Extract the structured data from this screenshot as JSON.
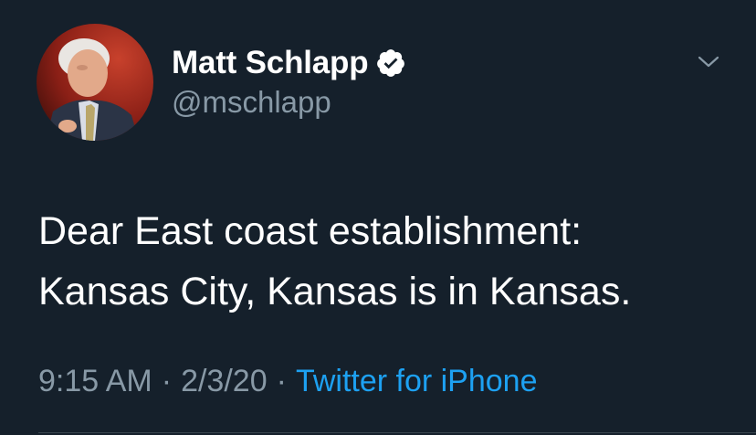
{
  "tweet": {
    "author": {
      "display_name": "Matt Schlapp",
      "handle": "@mschlapp",
      "verified": true,
      "avatar": "profile-photo"
    },
    "text_lines": [
      "Dear East coast establishment:",
      "Kansas City, Kansas is in Kansas."
    ],
    "time": "9:15 AM",
    "date": "2/3/20",
    "separator": "·",
    "source": "Twitter for iPhone"
  },
  "icons": {
    "verified": "verified-badge-icon",
    "menu": "chevron-down-icon"
  },
  "colors": {
    "background": "#15202b",
    "primary_text": "#ffffff",
    "secondary_text": "#8899a6",
    "link": "#1da1f2",
    "divider": "#38444d"
  }
}
